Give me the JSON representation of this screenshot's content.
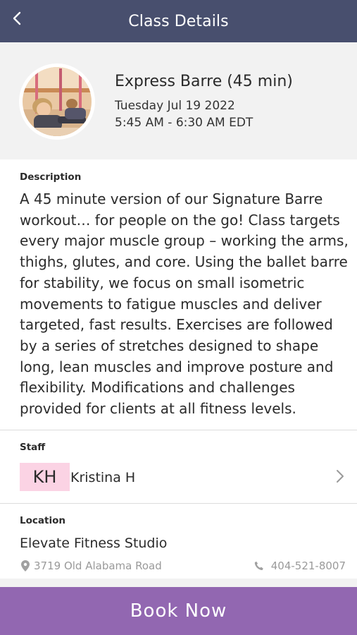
{
  "header": {
    "title": "Class Details",
    "back_icon": "chevron-left-icon",
    "background": "#484f6e"
  },
  "class": {
    "name": "Express Barre (45 min)",
    "date": "Tuesday Jul 19 2022",
    "time": "5:45 AM - 6:30 AM EDT"
  },
  "description": {
    "label": "Description",
    "text": "A 45 minute version of our Signature Barre workout… for people on the go! Class targets every major muscle group – working the arms, thighs, glutes, and core. Using the ballet barre for stability, we focus on small isometric movements to fatigue muscles and deliver targeted, fast results. Exercises are followed by a series of stretches designed to shape long, lean muscles and improve posture and flexibility. Modifications and challenges provided for clients at all fitness levels."
  },
  "staff": {
    "label": "Staff",
    "initials": "KH",
    "name": "Kristina H",
    "initials_color": "#fbd3e4"
  },
  "location": {
    "label": "Location",
    "name": "Elevate Fitness Studio",
    "address": "3719 Old Alabama Road",
    "phone": "404-521-8007"
  },
  "book_button": {
    "label": "Book Now",
    "color": "#9267b1"
  }
}
